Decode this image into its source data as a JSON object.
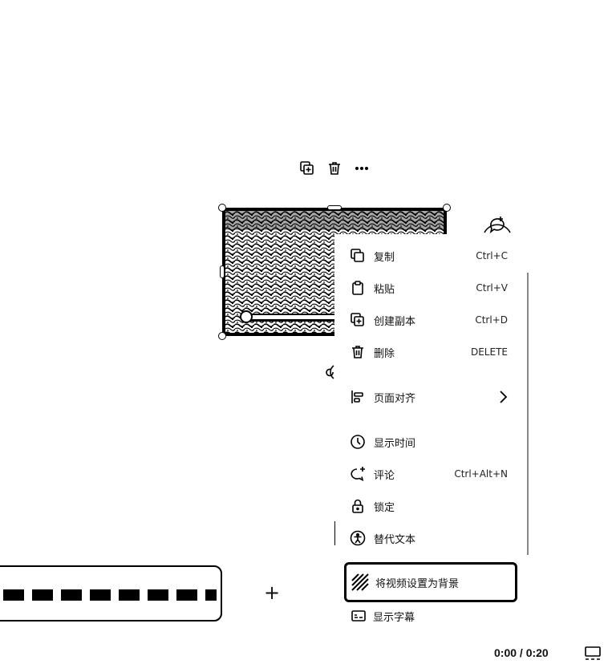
{
  "toolbar": {
    "duplicate_icon": "copy-plus-icon",
    "delete_icon": "trash-icon",
    "more_icon": "more-dots-icon"
  },
  "canvas": {
    "rotate_icon": "rotate-icon",
    "comment_icon": "add-comment-icon"
  },
  "context_menu": {
    "items": [
      {
        "label": "复制",
        "shortcut": "Ctrl+C",
        "icon": "copy-icon"
      },
      {
        "label": "粘贴",
        "shortcut": "Ctrl+V",
        "icon": "clipboard-icon"
      },
      {
        "label": "创建副本",
        "shortcut": "Ctrl+D",
        "icon": "duplicate-icon"
      },
      {
        "label": "删除",
        "shortcut": "DELETE",
        "icon": "trash-icon"
      },
      {
        "label": "页面对齐",
        "shortcut": "",
        "icon": "align-page-icon",
        "submenu": true
      },
      {
        "label": "显示时间",
        "shortcut": "",
        "icon": "clock-icon"
      },
      {
        "label": "评论",
        "shortcut": "Ctrl+Alt+N",
        "icon": "comment-icon"
      },
      {
        "label": "锁定",
        "shortcut": "",
        "icon": "lock-icon"
      },
      {
        "label": "替代文本",
        "shortcut": "",
        "icon": "accessibility-icon"
      }
    ],
    "set_background": {
      "label": "将视频设置为背景",
      "icon": "striped-background-icon"
    },
    "show_subtitles": {
      "label": "显示字幕",
      "icon": "subtitles-icon"
    }
  },
  "timeline": {
    "thumb_count": 8,
    "add_page_label": "+"
  },
  "player": {
    "time": "0:00 / 0:20",
    "view_icon": "grid-view-icon"
  }
}
